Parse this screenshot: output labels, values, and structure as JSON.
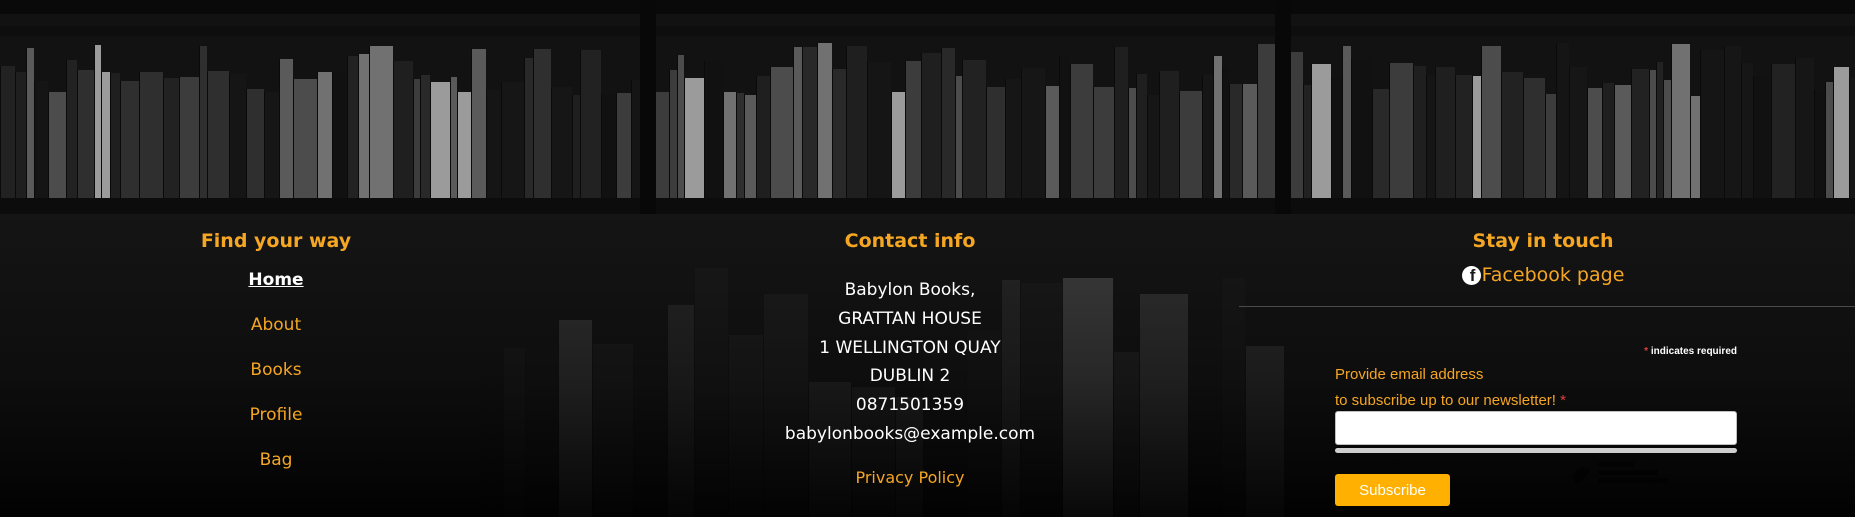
{
  "navigation": {
    "heading": "Find your way",
    "links": [
      {
        "label": "Home"
      },
      {
        "label": "About"
      },
      {
        "label": "Books"
      },
      {
        "label": "Profile"
      },
      {
        "label": "Bag"
      }
    ]
  },
  "contact": {
    "heading": "Contact info",
    "lines": [
      "Babylon Books,",
      "GRATTAN HOUSE",
      "1 WELLINGTON QUAY",
      "DUBLIN 2",
      "0871501359",
      "babylonbooks@example.com"
    ],
    "privacy_label": "Privacy Policy"
  },
  "social": {
    "heading": "Stay in touch",
    "facebook_label": "Facebook page",
    "facebook_icon": "facebook-icon"
  },
  "newsletter": {
    "required_star": "*",
    "required_note": "indicates required",
    "label_line1": "Provide email address",
    "label_line2": "to subscribe up to our newsletter!",
    "email_value": "",
    "subscribe_label": "Subscribe"
  },
  "colors": {
    "accent": "#f5a623",
    "button": "#ffb000",
    "required": "#e04040",
    "text": "#ffffff",
    "background": "#161616"
  }
}
